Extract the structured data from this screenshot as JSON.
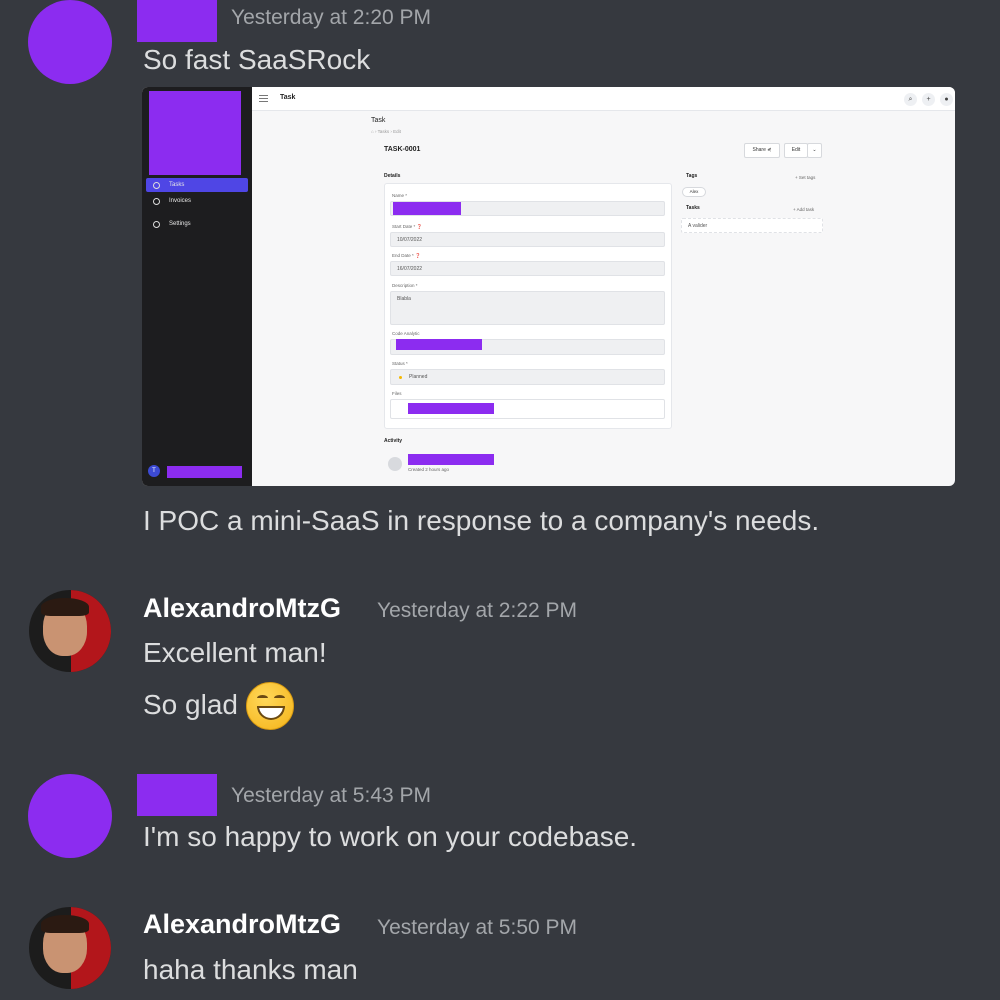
{
  "colors": {
    "background": "#36393f",
    "redaction": "#8c2cf0",
    "timestamp": "#a3a6aa",
    "username": "#ffffff",
    "message": "#dcddde"
  },
  "messages": [
    {
      "author_redacted": true,
      "timestamp": "Yesterday at 2:20 PM",
      "lines": [
        "So fast SaaSRock",
        "I POC a mini-SaaS in response to a company's needs."
      ],
      "has_screenshot": true
    },
    {
      "author": "AlexandroMtzG",
      "timestamp": "Yesterday at 2:22 PM",
      "lines": [
        "Excellent man!",
        "So glad"
      ],
      "emoji": "grinning-face"
    },
    {
      "author_redacted": true,
      "timestamp": "Yesterday at 5:43 PM",
      "lines": [
        "I'm so happy to work on your codebase."
      ]
    },
    {
      "author": "AlexandroMtzG",
      "timestamp": "Yesterday at 5:50 PM",
      "lines": [
        "haha thanks man"
      ]
    }
  ],
  "screenshot": {
    "sidebar": {
      "items": [
        "Tasks",
        "Invoices",
        "Settings"
      ],
      "active_item": "Tasks",
      "user_initial": "T"
    },
    "topbar_title": "Task",
    "page_title": "Task",
    "breadcrumb": "⌂ › Tasks › Edit",
    "record_id": "TASK-0001",
    "buttons": {
      "share": "Share ⋞",
      "edit": "Edit",
      "edit_dropdown": "⌄"
    },
    "details_heading": "Details",
    "fields": {
      "name_label": "Name *",
      "start_date_label": "Start Date * ❓",
      "start_date_value": "10/07/2022",
      "end_date_label": "End Date * ❓",
      "end_date_value": "16/07/2022",
      "description_label": "Description *",
      "description_value": "Blabla",
      "code_analytic_label": "Code Analytic",
      "status_label": "Status *",
      "status_value": "Planned",
      "files_label": "Files"
    },
    "tags": {
      "heading": "Tags",
      "action": "+ Set tags",
      "items": [
        "Alex"
      ]
    },
    "tasks": {
      "heading": "Tasks",
      "action": "+ Add task",
      "items": [
        "A valider"
      ]
    },
    "activity": {
      "heading": "Activity",
      "entry_time": "Created 2 hours ago"
    }
  }
}
